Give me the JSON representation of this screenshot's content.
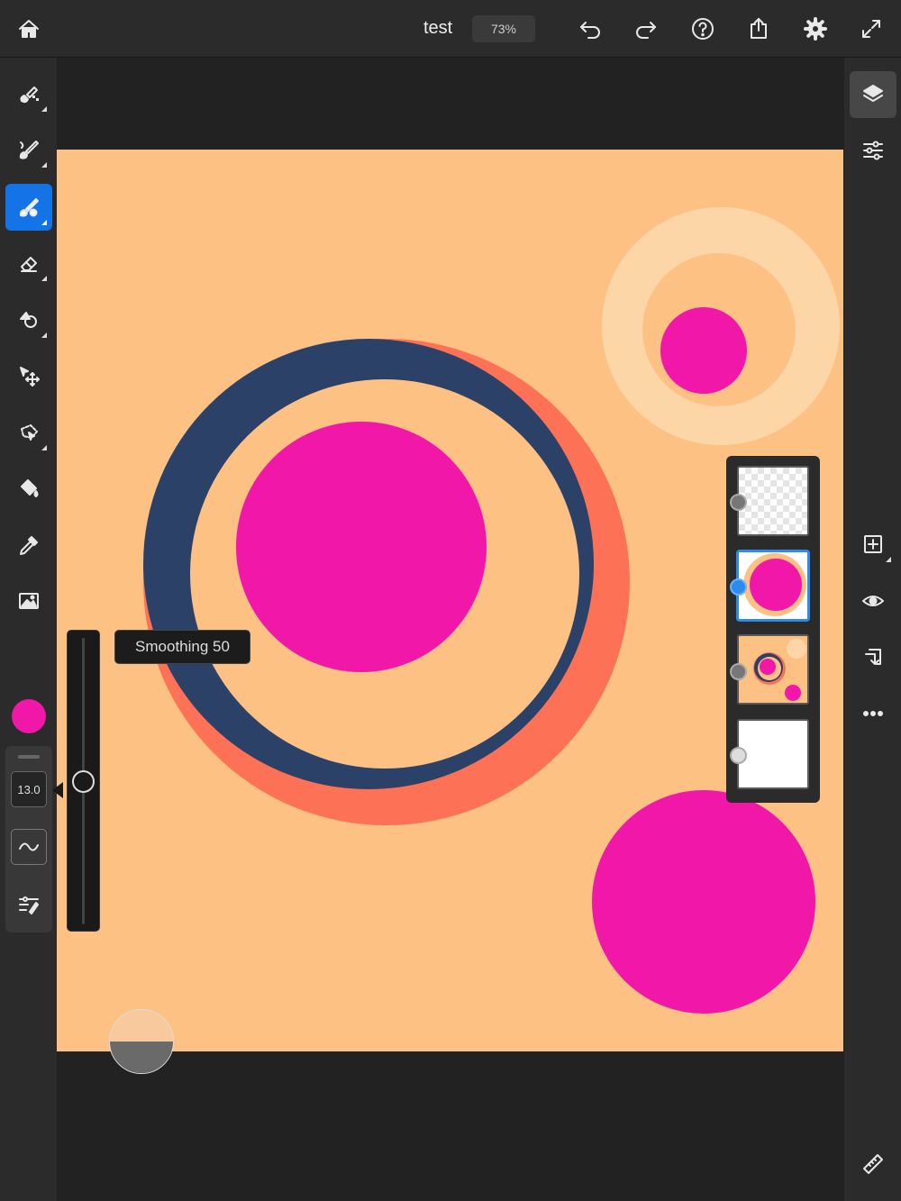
{
  "topbar": {
    "title": "test",
    "zoom": "73%",
    "icons": [
      "home-icon",
      "undo-icon",
      "redo-icon",
      "help-icon",
      "share-icon",
      "settings-icon",
      "fullscreen-icon"
    ]
  },
  "left_toolbar": {
    "tools": [
      "pixel-brush-icon",
      "live-brush-icon",
      "paint-brush-icon",
      "eraser-icon",
      "smudge-icon",
      "move-icon",
      "lasso-icon",
      "fill-icon",
      "eyedropper-icon",
      "place-image-icon"
    ],
    "active_tool": "paint-brush-icon",
    "brush_color": "#f117a8",
    "brush_size": "13.0"
  },
  "smoothing": {
    "tooltip": "Smoothing 50",
    "value": 50
  },
  "canvas": {
    "background": "#fdc184",
    "colors": {
      "magenta": "#f117a8",
      "navy": "#2b4168",
      "coral": "#fd7256",
      "light": "#fdd6a8"
    }
  },
  "right_toolbar": {
    "icons": [
      "layers-icon",
      "properties-icon",
      "add-layer-icon",
      "visibility-icon",
      "merge-icon",
      "more-icon",
      "ruler-icon"
    ]
  },
  "layers": {
    "selected_index": 1,
    "items": [
      {
        "name": "transparent-layer",
        "type": "transparent"
      },
      {
        "name": "circle-layer",
        "type": "pixel"
      },
      {
        "name": "rings-layer",
        "type": "pixel"
      },
      {
        "name": "background-layer",
        "type": "image"
      }
    ]
  }
}
